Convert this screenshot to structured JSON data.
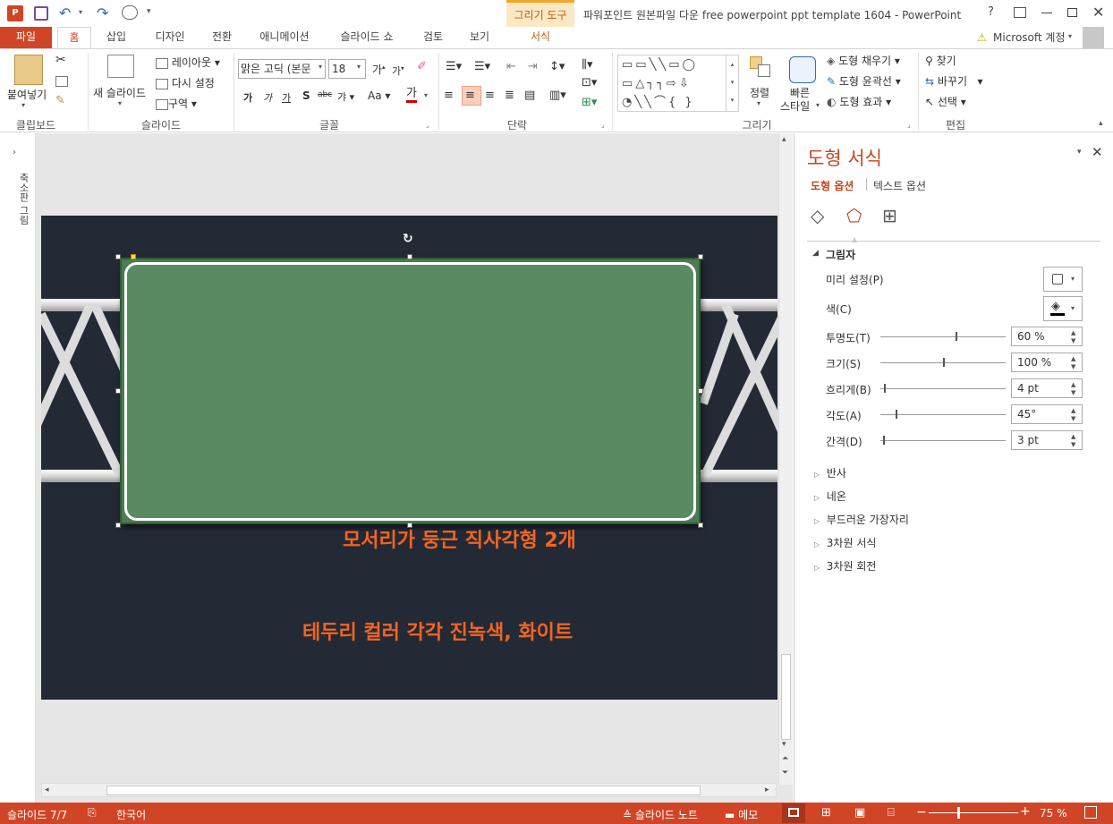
{
  "app": {
    "window_title": "파워포인트 원본파일 다운 free powerpoint ppt template 1604 - PowerPoint",
    "context_tab_group": "그리기 도구",
    "account": "Microsoft 계정",
    "help": "?"
  },
  "tabs": [
    "파일",
    "홈",
    "삽입",
    "디자인",
    "전환",
    "애니메이션",
    "슬라이드 쇼",
    "검토",
    "보기",
    "서식"
  ],
  "ribbon": {
    "clipboard": {
      "paste": "붙여넣기",
      "label": "클립보드"
    },
    "slides": {
      "new_slide": "새 슬라이드",
      "layout": "레이아웃",
      "reset": "다시 설정",
      "section": "구역",
      "label": "슬라이드"
    },
    "font": {
      "name": "맑은 고딕 (본문",
      "size": "18",
      "label": "글꼴",
      "change_case": "Aa",
      "font_color": "가"
    },
    "paragraph": {
      "label": "단락"
    },
    "drawing": {
      "arrange": "정렬",
      "quick_styles_1": "빠른",
      "quick_styles_2": "스타일",
      "fill": "도형 채우기",
      "outline": "도형 윤곽선",
      "effects": "도형 효과",
      "label": "그리기"
    },
    "editing": {
      "find": "찾기",
      "replace": "바꾸기",
      "select": "선택",
      "label": "편집"
    }
  },
  "left_strip": {
    "label": "축소판 그림"
  },
  "slide": {
    "line1": "모서리가 둥근 직사각형 2개",
    "line2": "테두리 컬러 각각 진녹색, 화이트",
    "shape_fill": "#5a8a62",
    "background": "#232a36",
    "text_color": "#f26522"
  },
  "pane": {
    "title": "도형 서식",
    "tab_shape": "도형 옵션",
    "tab_text": "텍스트 옵션",
    "shadow_section": "그림자",
    "preset_label": "미리 설정(P)",
    "color_label": "색(C)",
    "props": [
      {
        "label": "투명도(T)",
        "value": "60 %",
        "level": 0.6
      },
      {
        "label": "크기(S)",
        "value": "100 %",
        "level": 0.5
      },
      {
        "label": "흐리게(B)",
        "value": "4 pt",
        "level": 0.03
      },
      {
        "label": "각도(A)",
        "value": "45°",
        "level": 0.12
      },
      {
        "label": "간격(D)",
        "value": "3 pt",
        "level": 0.02
      }
    ],
    "sections": [
      "반사",
      "네온",
      "부드러운 가장자리",
      "3차원 서식",
      "3차원 회전"
    ]
  },
  "status": {
    "slide_count": "슬라이드 7/7",
    "language": "한국어",
    "notes": "슬라이드 노트",
    "comments": "메모",
    "zoom": "75 %"
  },
  "colors": {
    "accent": "#d04526",
    "context_tab": "#f4a62a"
  }
}
